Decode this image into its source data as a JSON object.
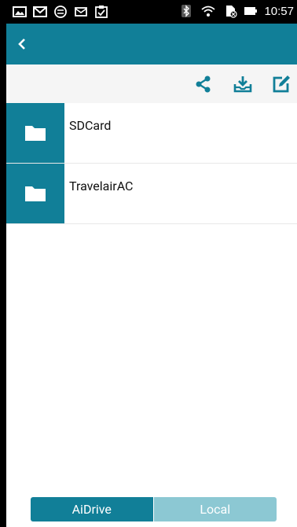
{
  "status_bar": {
    "time": "10:57",
    "icons_left": [
      "image-icon",
      "gmail-icon",
      "sync-icon",
      "mail-icon",
      "clipboard-icon"
    ],
    "icons_right": [
      "bluetooth-icon",
      "wifi-icon",
      "sim-icon",
      "battery-icon"
    ]
  },
  "app_bar": {
    "back_icon": "chevron-left-icon",
    "background": "#117f98"
  },
  "toolbar": {
    "actions": [
      "share-icon",
      "download-icon",
      "edit-icon"
    ]
  },
  "files": [
    {
      "name": "SDCard",
      "icon": "folder-icon"
    },
    {
      "name": "TravelairAC",
      "icon": "folder-icon"
    }
  ],
  "tabs": [
    {
      "label": "AiDrive",
      "selected": true
    },
    {
      "label": "Local",
      "selected": false
    }
  ],
  "colors": {
    "accent": "#117f98",
    "tab_inactive": "#8cc8d3"
  }
}
